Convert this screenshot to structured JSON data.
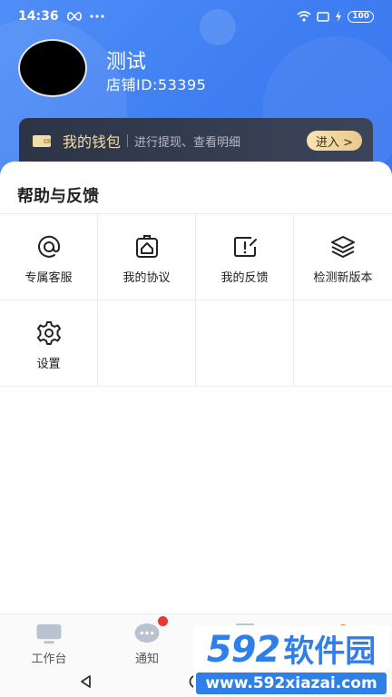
{
  "status_bar": {
    "time": "14:36",
    "battery": "100"
  },
  "profile": {
    "name": "测试",
    "shop_id": "店铺ID:53395"
  },
  "wallet": {
    "title": "我的钱包",
    "description": "进行提现、查看明细",
    "enter_label": "进入 >"
  },
  "help": {
    "title": "帮助与反馈",
    "items": [
      {
        "label": "专属客服",
        "icon": "at-sign-icon"
      },
      {
        "label": "我的协议",
        "icon": "agreement-icon"
      },
      {
        "label": "我的反馈",
        "icon": "feedback-icon"
      },
      {
        "label": "检测新版本",
        "icon": "layers-icon"
      },
      {
        "label": "设置",
        "icon": "gear-icon"
      }
    ]
  },
  "tabs": [
    {
      "label": "工作台",
      "icon": "monitor-icon"
    },
    {
      "label": "通知",
      "icon": "chat-bubble-icon"
    },
    {
      "label": "",
      "icon": "document-icon"
    },
    {
      "label": "",
      "icon": "profile-icon"
    }
  ],
  "watermark": {
    "number": "592",
    "text": "软件园",
    "url": "www.592xiazai.com"
  },
  "colors": {
    "primary_blue": "#3f7ef2",
    "wallet_dark": "#2c3446",
    "wallet_gold": "#f3dca8",
    "badge_red": "#e53935"
  }
}
